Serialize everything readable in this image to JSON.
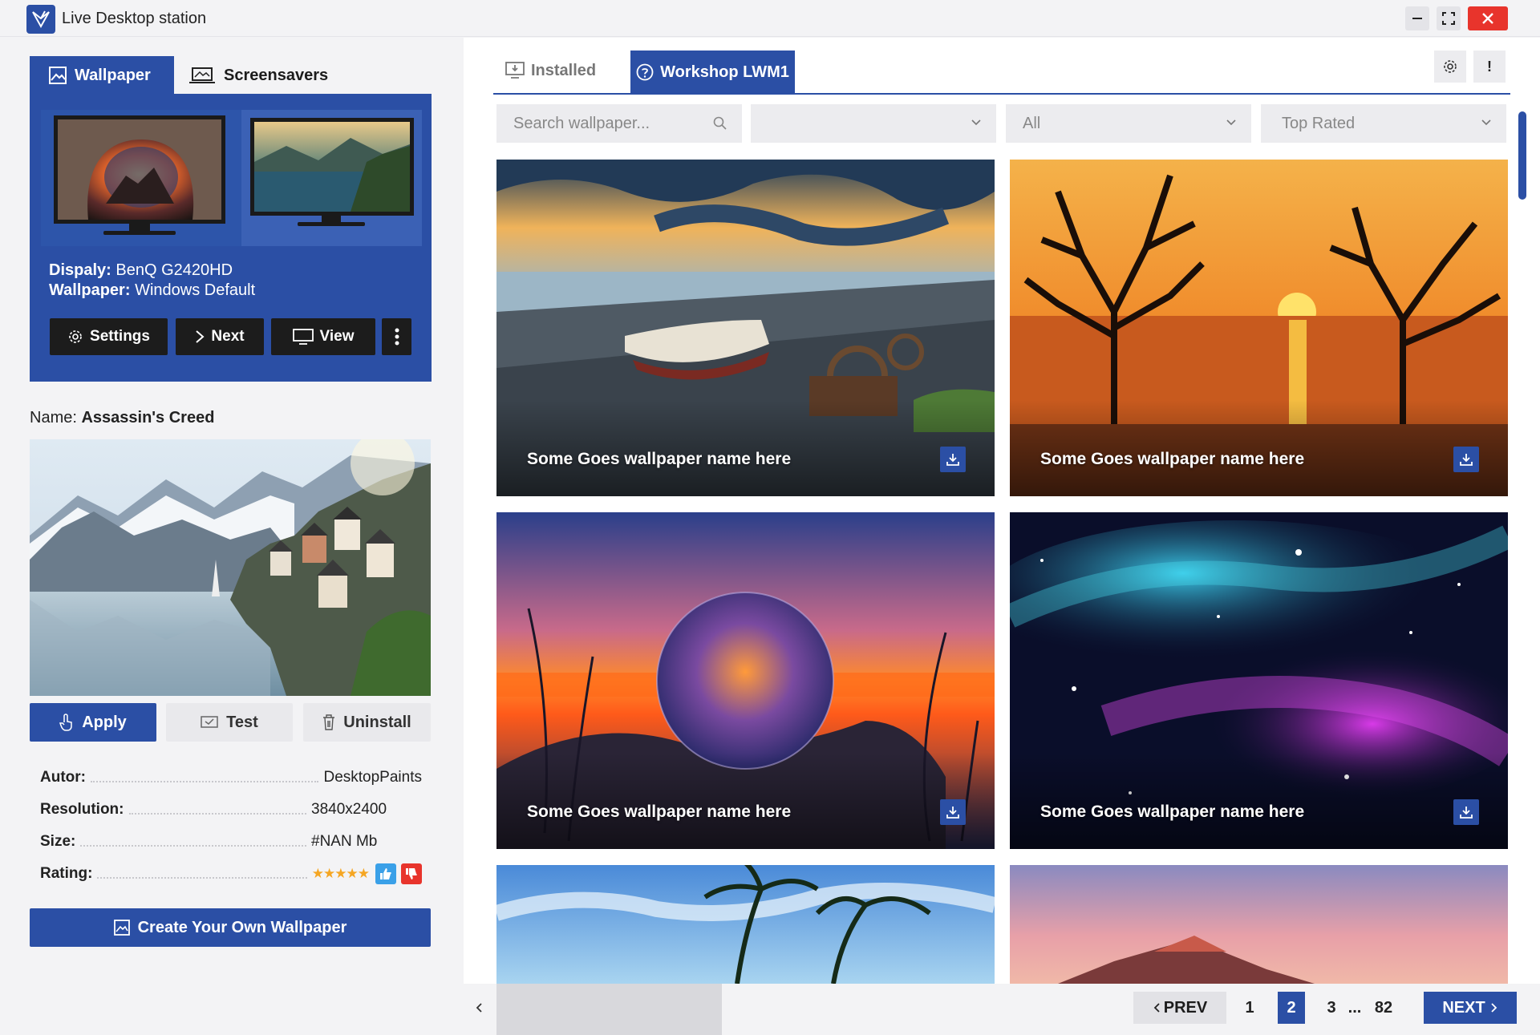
{
  "app": {
    "title": "Live Desktop station"
  },
  "left": {
    "tabs": {
      "wallpaper": "Wallpaper",
      "screensavers": "Screensavers"
    },
    "display": {
      "display_label": "Dispaly:",
      "display_value": "BenQ G2420HD",
      "wallpaper_label": "Wallpaper:",
      "wallpaper_value": "Windows Default"
    },
    "buttons": {
      "settings": "Settings",
      "next": "Next",
      "view": "View"
    },
    "name_label": "Name:",
    "name_value": "Assassin's Creed",
    "actions": {
      "apply": "Apply",
      "test": "Test",
      "uninstall": "Uninstall"
    },
    "info": [
      {
        "key": "Autor:",
        "value": "DesktopPaints"
      },
      {
        "key": "Resolution:",
        "value": "3840x2400"
      },
      {
        "key": "Size:",
        "value": "#NAN Mb"
      },
      {
        "key": "Rating:",
        "value": "★★★★★"
      }
    ],
    "create": "Create Your Own Wallpaper"
  },
  "right": {
    "tabs": {
      "installed": "Installed",
      "workshop": "Workshop LWM1"
    },
    "search_placeholder": "Search wallpaper...",
    "filters": {
      "category": "",
      "type": "All",
      "sort": "Top Rated"
    },
    "cards": [
      {
        "title": "Some Goes wallpaper name here"
      },
      {
        "title": "Some Goes wallpaper name here"
      },
      {
        "title": "Some Goes wallpaper name here"
      },
      {
        "title": "Some Goes wallpaper name here"
      },
      {
        "title": ""
      },
      {
        "title": ""
      }
    ],
    "pagination": {
      "prev": "PREV",
      "pages": [
        "1",
        "2",
        "3",
        "...",
        "82"
      ],
      "current": "2",
      "next": "NEXT"
    }
  },
  "colors": {
    "accent": "#2b4fa5",
    "close": "#e8342c",
    "star": "#f5a623",
    "like": "#3aa0e8",
    "dislike": "#e8342c"
  }
}
